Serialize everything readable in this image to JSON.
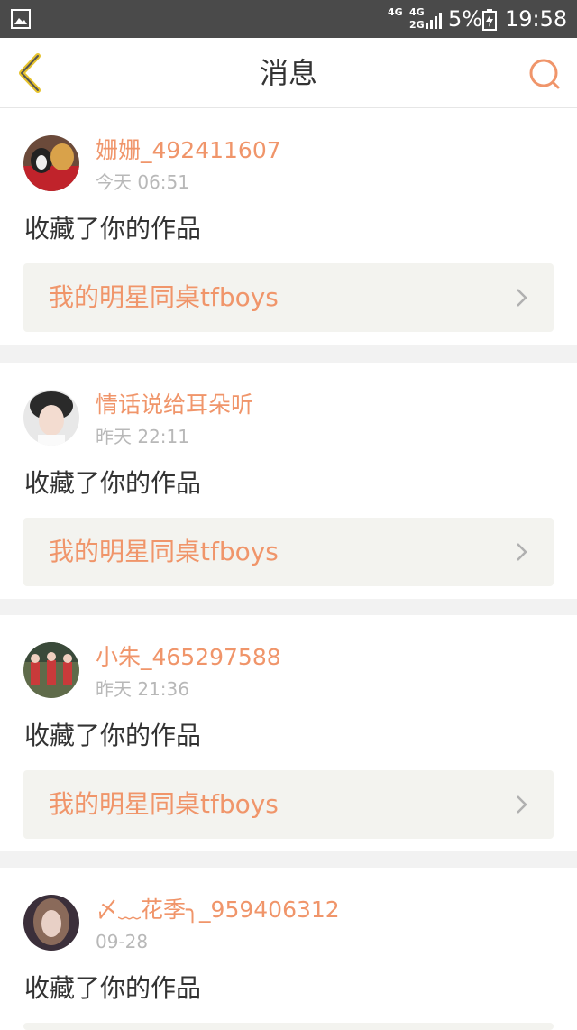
{
  "status_bar": {
    "net1": "4G",
    "net2": "4G",
    "net2b": "2G",
    "battery": "5%",
    "time": "19:58",
    "icons": [
      "gallery-icon",
      "signal-icon",
      "battery-charging-icon"
    ]
  },
  "header": {
    "title": "消息",
    "back_icon": "chevron-left-icon",
    "search_icon": "search-icon",
    "accent_color": "#f0956a"
  },
  "messages": [
    {
      "username": "姗姗_492411607",
      "time": "今天 06:51",
      "action": "收藏了你的作品",
      "work": "我的明星同桌tfboys"
    },
    {
      "username": "情话说给耳朵听",
      "time": "昨天 22:11",
      "action": "收藏了你的作品",
      "work": "我的明星同桌tfboys"
    },
    {
      "username": "小朱_465297588",
      "time": "昨天 21:36",
      "action": "收藏了你的作品",
      "work": "我的明星同桌tfboys"
    },
    {
      "username": "〆﹏花季╮_959406312",
      "time": "09-28",
      "action": "收藏了你的作品",
      "work": ""
    }
  ]
}
